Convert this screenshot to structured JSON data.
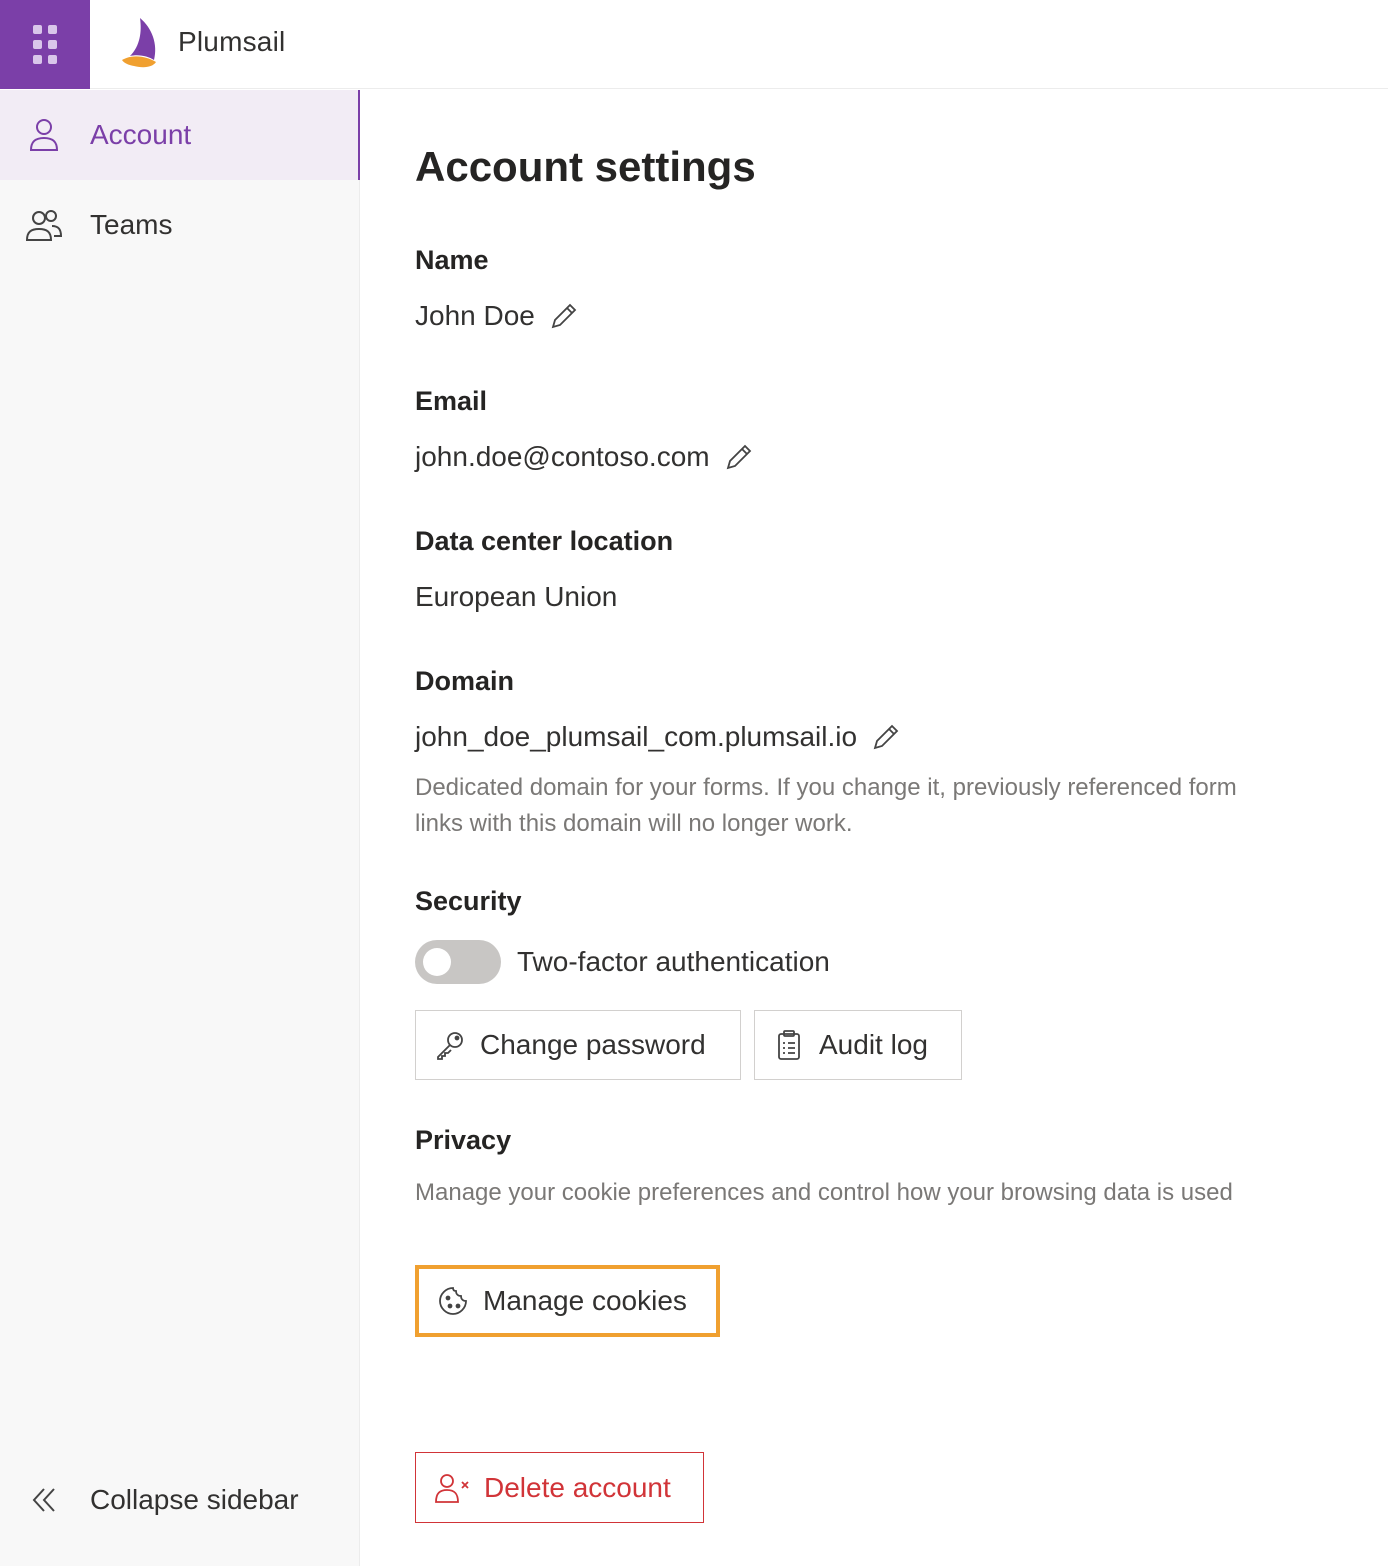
{
  "app": {
    "brand": "Plumsail"
  },
  "colors": {
    "accent": "#7b3fa8",
    "logo_orange": "#f0a030",
    "danger": "#d13438",
    "highlight": "#f0a030"
  },
  "icons": {
    "waffle": "app-launcher-icon",
    "logo": "plumsail-logo-icon",
    "account": "person-icon",
    "teams": "people-icon",
    "collapse": "double-chevron-left-icon",
    "edit": "pencil-icon",
    "key": "key-icon",
    "audit": "clipboard-list-icon",
    "cookie": "cookie-icon",
    "delete_user": "person-remove-icon"
  },
  "sidebar": {
    "items": [
      {
        "label": "Account",
        "active": true
      },
      {
        "label": "Teams",
        "active": false
      }
    ],
    "collapse_label": "Collapse sidebar"
  },
  "main": {
    "title": "Account settings",
    "name": {
      "label": "Name",
      "value": "John Doe"
    },
    "email": {
      "label": "Email",
      "value": "john.doe@contoso.com"
    },
    "datacenter": {
      "label": "Data center location",
      "value": "European Union"
    },
    "domain": {
      "label": "Domain",
      "value": "john_doe_plumsail_com.plumsail.io",
      "helper": "Dedicated domain for your forms. If you change it, previously referenced form links with this domain will no longer work."
    },
    "security": {
      "label": "Security",
      "two_factor_label": "Two-factor authentication",
      "two_factor_enabled": false,
      "change_password_label": "Change password",
      "audit_log_label": "Audit log"
    },
    "privacy": {
      "label": "Privacy",
      "helper": "Manage your cookie preferences and control how your browsing data is used",
      "manage_cookies_label": "Manage cookies"
    },
    "delete_account_label": "Delete account"
  }
}
